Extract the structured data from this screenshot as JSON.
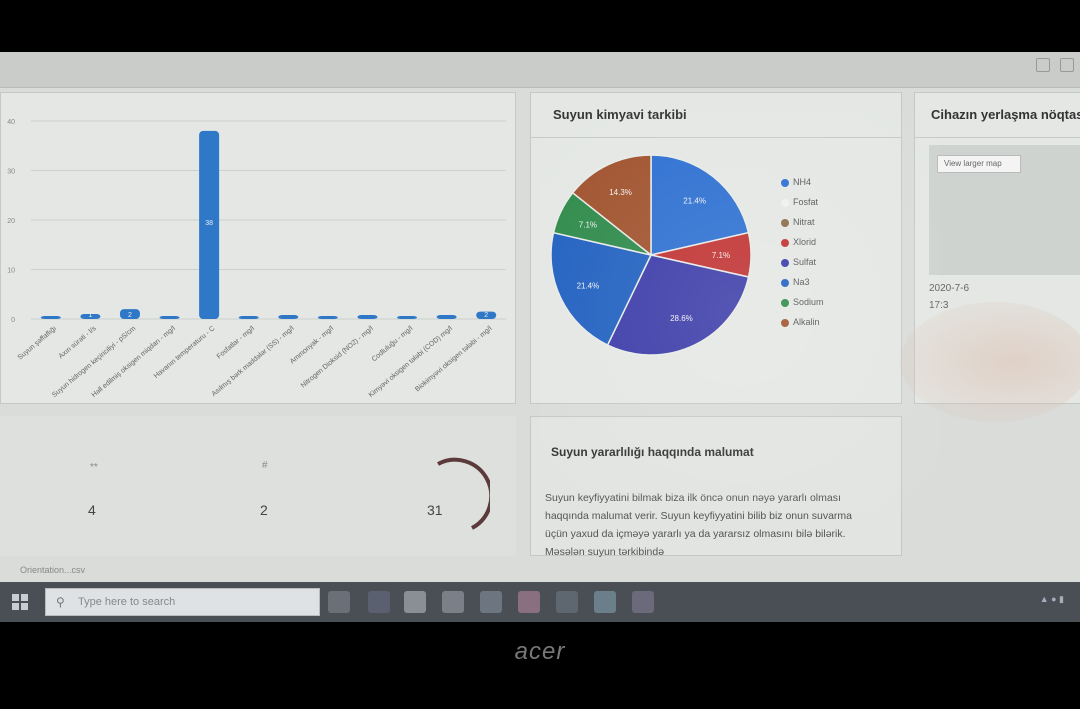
{
  "bar_chart": {
    "chart_data": {
      "type": "bar",
      "categories": [
        "Suyun şəffaflığı",
        "Axın sürəti - l/s",
        "Suyun hidrogen keçiriciliyi - pS/cm",
        "Həll edilmiş oksigen miqdarı - mg/l",
        "Havanın temperaturu - C",
        "Fosfatlar - mg/l",
        "Asılmış bərk maddələr (SS) - mg/l",
        "Ammonyak - mg/l",
        "Nitrogen Dioksid (NO2) - mg/l",
        "Codluluğu - mg/l",
        "Kimyəvi oksigen tələbi (COD) mg/l",
        "Biokimyəvi oksigen tələbi - mg/l"
      ],
      "values": [
        0.2,
        1,
        2,
        0.6,
        38,
        0.3,
        0.8,
        0.3,
        0.8,
        0.2,
        0.8,
        1.5
      ],
      "ylim": [
        0,
        40
      ],
      "yticks": [
        "0",
        "10",
        "20",
        "30",
        "40"
      ],
      "color": "#2f78c8"
    },
    "value_labels": [
      "",
      "1",
      "2",
      "",
      "38",
      "",
      "",
      "",
      "",
      "",
      "",
      "2"
    ]
  },
  "pie_card": {
    "title": "Suyun kimyavi tarkibi",
    "chart_data": {
      "type": "pie",
      "labels": [
        "NH4",
        "Fosfat",
        "Nitrat",
        "Xlorid",
        "Sulfat",
        "Na3",
        "Sodium",
        "Alkalin"
      ],
      "values": [
        21.4,
        0,
        0,
        7.1,
        28.6,
        21.4,
        7.1,
        14.3
      ],
      "colors": [
        "#2c6fd1",
        "#f0f0f0",
        "#8b6a4a",
        "#c03030",
        "#3a3aa8",
        "#2060c0",
        "#2e8a4a",
        "#a0522d"
      ]
    },
    "slice_labels": [
      "21.4%",
      "",
      "",
      "7.1%",
      "28.6%",
      "21.4%",
      "7.1%",
      "14.3%"
    ]
  },
  "map_card": {
    "title": "Cihazın yerlaşma nöqtası",
    "button": "View larger map",
    "date": "2020-7-6",
    "time": "17:3"
  },
  "info_card": {
    "title": "Suyun yararlılığı haqqında malumat",
    "text": "Suyun keyfiyyatini bilmak biza ilk öncə onun nəyə yararlı olması haqqında malumat verir. Suyun keyfiyyatini bilib biz onun suvarma üçün yaxud da içməyə yararlı ya da yararsız olmasını bilə bilərik. Məsələn suyun tərkibində"
  },
  "stats": {
    "values": [
      "4",
      "2",
      "31"
    ],
    "captions": [
      "**",
      "#",
      ""
    ]
  },
  "taskbar": {
    "search_placeholder": "Type here to search"
  },
  "download_bar": {
    "file": "Orientation...csv"
  },
  "brand": "acer"
}
